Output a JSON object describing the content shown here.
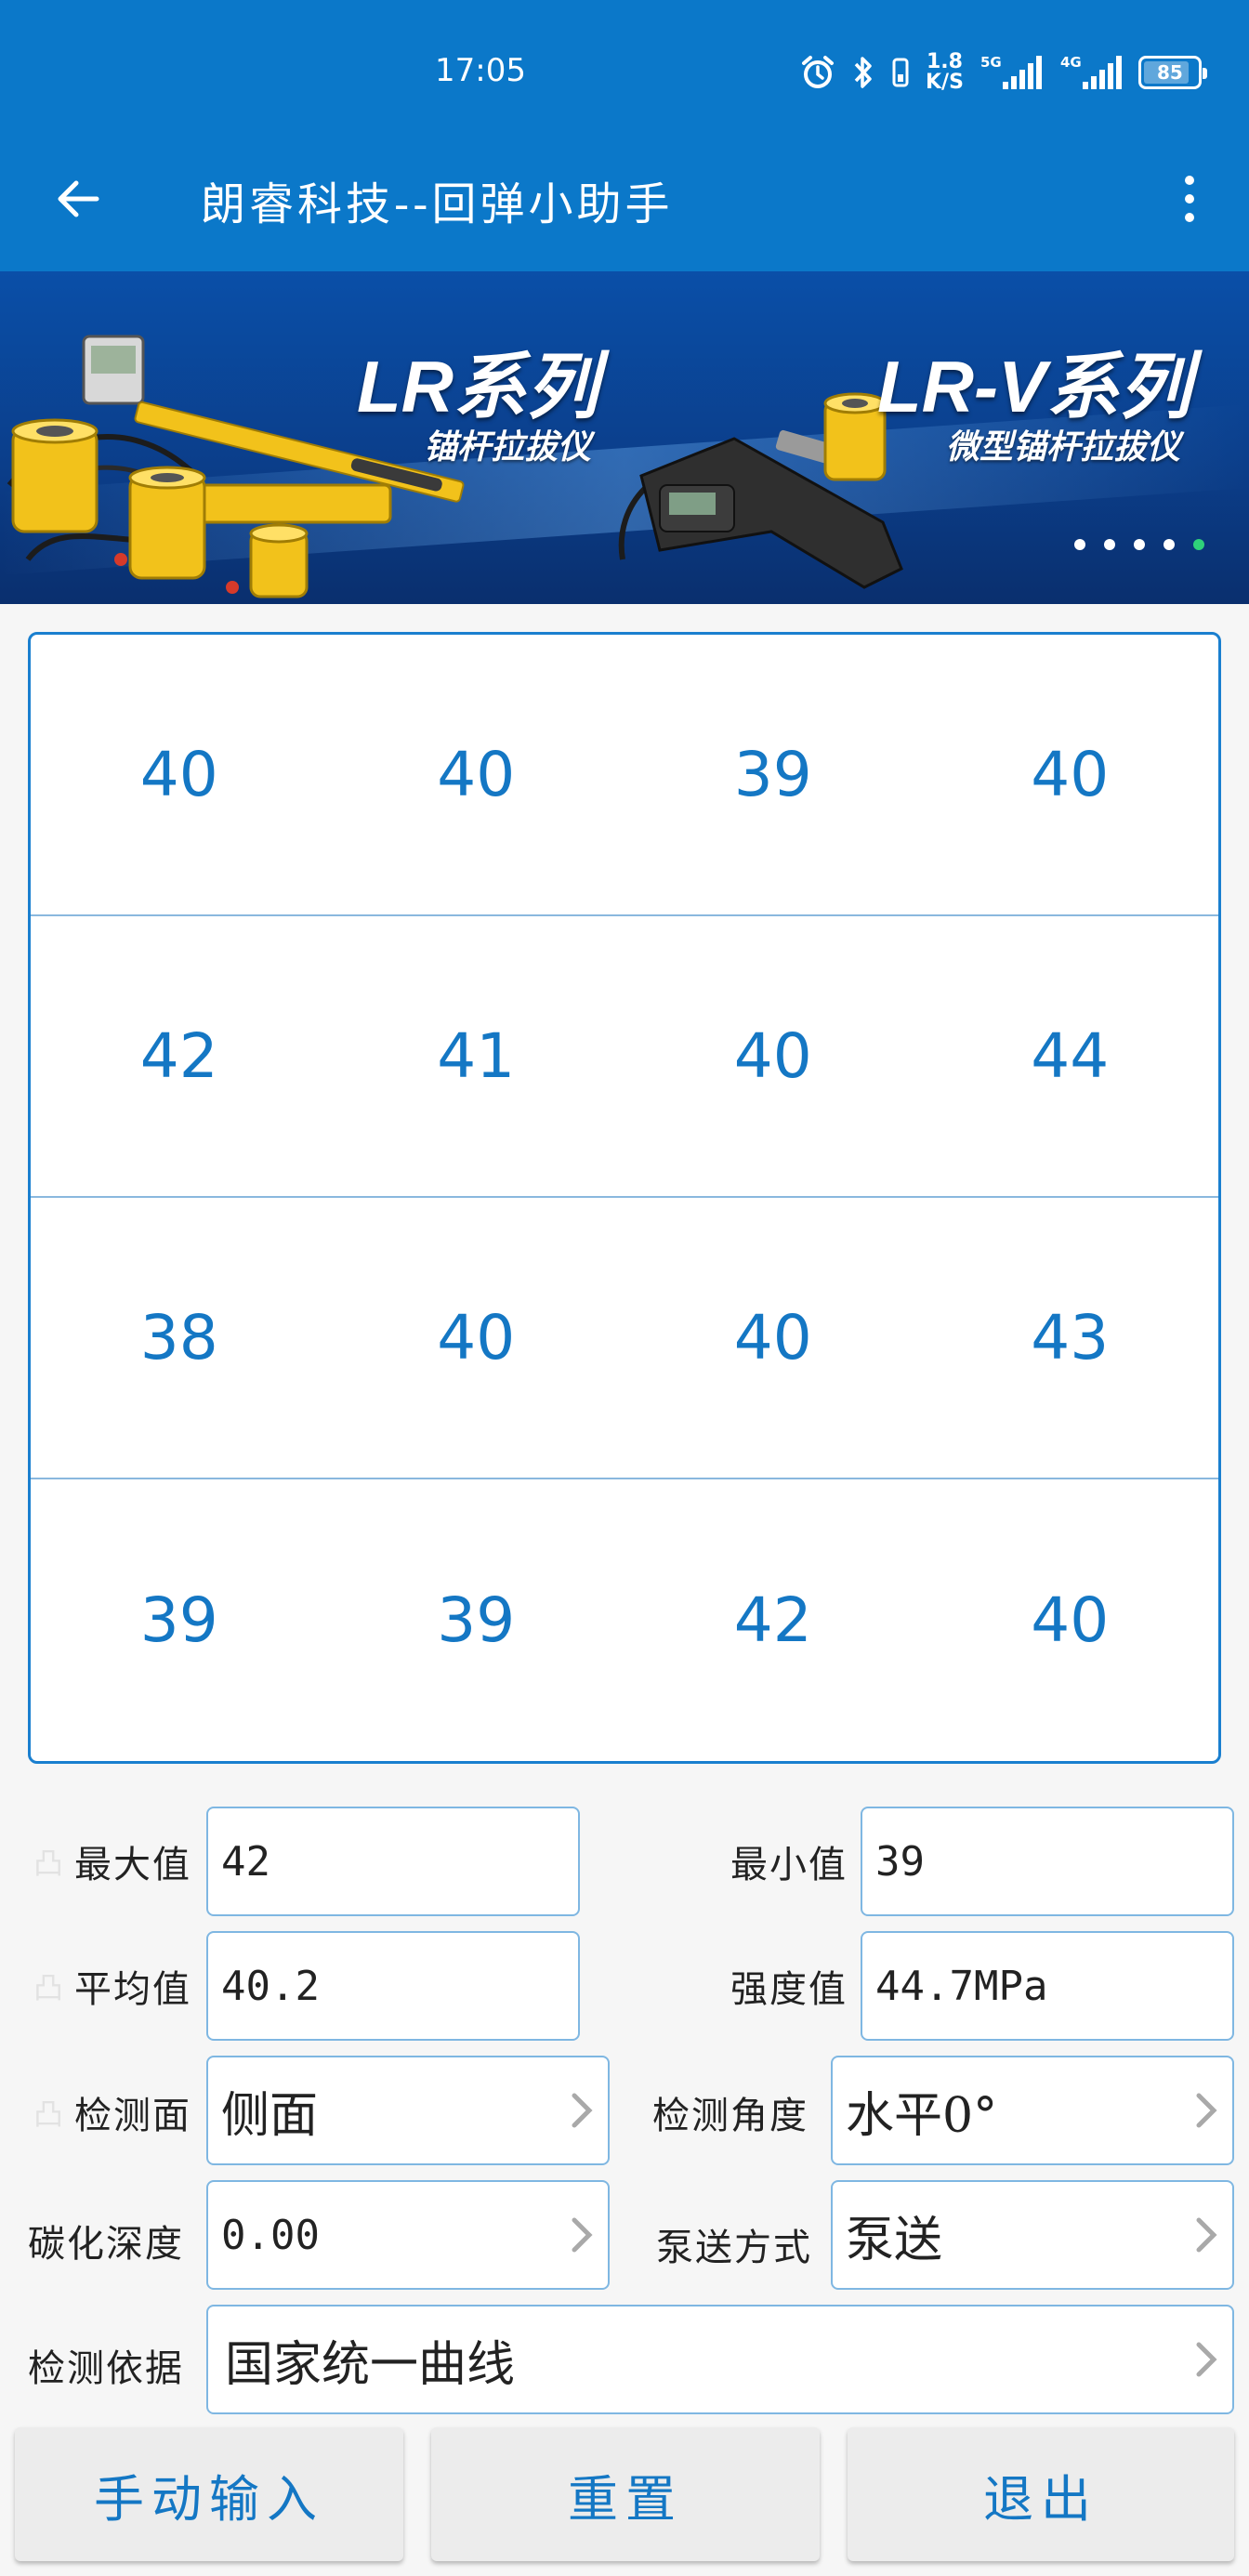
{
  "status_bar": {
    "time": "17:05",
    "net_speed_value": "1.8",
    "net_speed_unit": "K/S",
    "signal_label_1": "5G",
    "signal_label_2": "4G",
    "battery": "85",
    "battery_level": 0.85
  },
  "app_bar": {
    "title": "朗睿科技--回弹小助手"
  },
  "banner": {
    "left_title": "LR系列",
    "left_subtitle": "锚杆拉拔仪",
    "right_title": "LR-V系列",
    "right_subtitle": "微型锚杆拉拔仪",
    "page_count": 5,
    "active_page": 5
  },
  "readings": [
    [
      "40",
      "40",
      "39",
      "40"
    ],
    [
      "42",
      "41",
      "40",
      "44"
    ],
    [
      "38",
      "40",
      "40",
      "43"
    ],
    [
      "39",
      "39",
      "42",
      "40"
    ]
  ],
  "form": {
    "max_label": "最大值",
    "max_value": "42",
    "min_label": "最小值",
    "min_value": "39",
    "avg_label": "平均值",
    "avg_value": "40.2",
    "strength_label": "强度值",
    "strength_value": "44.7MPa",
    "surface_label": "检测面",
    "surface_value": "侧面",
    "angle_label": "检测角度",
    "angle_value": "水平0°",
    "carbonation_label": "碳化深度",
    "carbonation_value": "0.00",
    "pumping_label": "泵送方式",
    "pumping_value": "泵送",
    "basis_label": "检测依据",
    "basis_value": "国家统一曲线"
  },
  "buttons": {
    "manual": "手动输入",
    "reset": "重置",
    "exit": "退出"
  },
  "colors": {
    "primary": "#0b78c9",
    "accent_text": "#1477c4",
    "field_border": "#7fb7e2",
    "active_dot": "#2fd17a"
  }
}
